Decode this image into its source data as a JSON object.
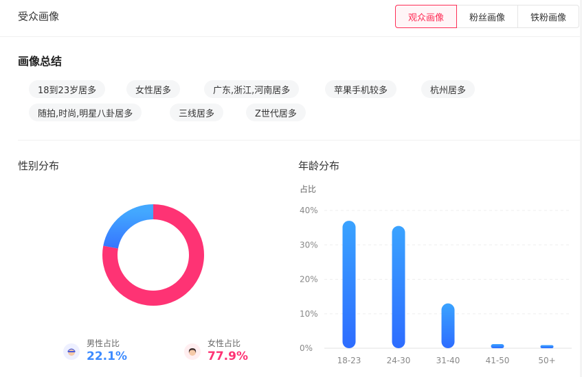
{
  "header": {
    "title": "受众画像",
    "tabs": [
      {
        "label": "观众画像",
        "active": true
      },
      {
        "label": "粉丝画像",
        "active": false
      },
      {
        "label": "铁粉画像",
        "active": false
      }
    ]
  },
  "summary": {
    "title": "画像总结",
    "tags": [
      "18到23岁居多",
      "女性居多",
      "广东,浙江,河南居多",
      "苹果手机较多",
      "杭州居多",
      "随拍,时尚,明星八卦居多",
      "三线居多",
      "Z世代居多"
    ]
  },
  "gender": {
    "title": "性别分布",
    "male_label": "男性占比",
    "male_value": "22.1%",
    "female_label": "女性占比",
    "female_value": "77.9%"
  },
  "age": {
    "title": "年龄分布"
  },
  "colors": {
    "brand": "#fe2c55",
    "male": "#3d8bff",
    "female": "#fe3374"
  },
  "chart_data": [
    {
      "type": "pie",
      "categories": [
        "男性占比",
        "女性占比"
      ],
      "values": [
        22.1,
        77.9
      ],
      "colors": [
        "#3b91ff",
        "#fe3374"
      ]
    },
    {
      "type": "bar",
      "ylabel": "占比",
      "categories": [
        "18-23",
        "24-30",
        "31-40",
        "41-50",
        "50+"
      ],
      "values": [
        37,
        35.5,
        13,
        1.2,
        0.9
      ],
      "ylim": [
        0,
        40
      ],
      "yticks": [
        "0%",
        "10%",
        "20%",
        "30%",
        "40%"
      ],
      "grid": true
    }
  ]
}
